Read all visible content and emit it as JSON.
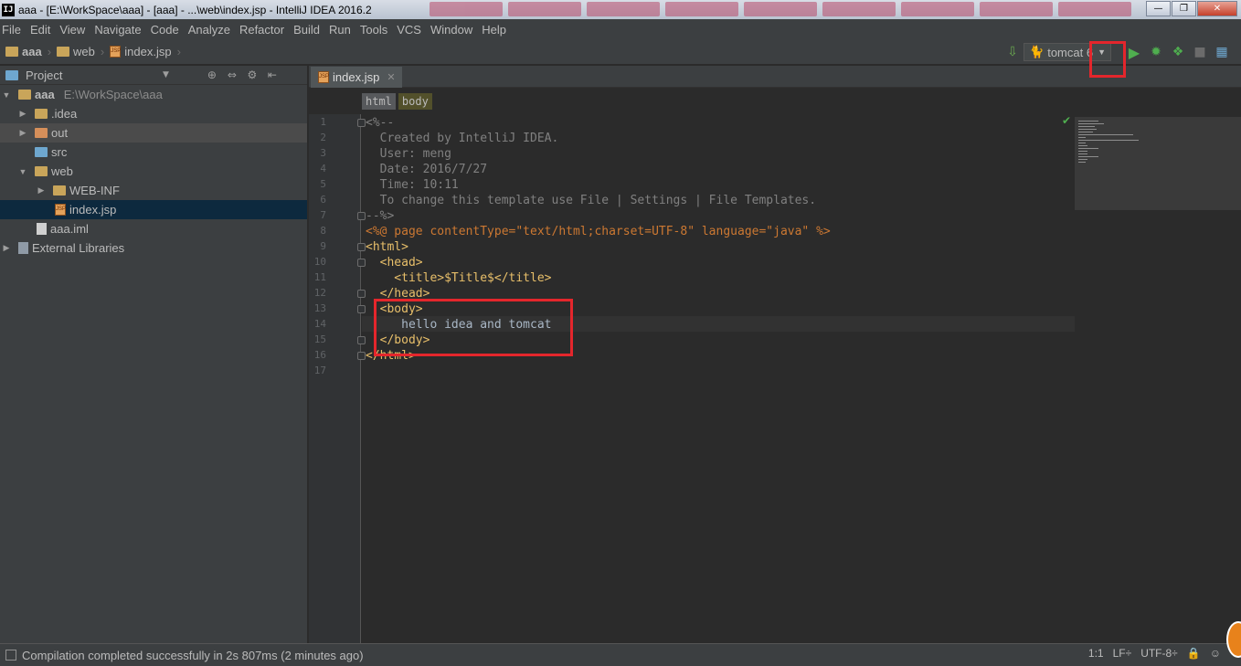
{
  "window": {
    "app_icon": "IJ",
    "title": "aaa - [E:\\WorkSpace\\aaa] - [aaa] - ...\\web\\index.jsp - IntelliJ IDEA 2016.2",
    "minimize": "—",
    "maximize": "❐",
    "close": "✕"
  },
  "menu": [
    "File",
    "Edit",
    "View",
    "Navigate",
    "Code",
    "Analyze",
    "Refactor",
    "Build",
    "Run",
    "Tools",
    "VCS",
    "Window",
    "Help"
  ],
  "navbar": {
    "crumbs": [
      "aaa",
      "web",
      "index.jsp"
    ],
    "run_config": "tomcat 6"
  },
  "project_panel": {
    "title": "Project",
    "tree": [
      {
        "label": "aaa",
        "path": "E:\\WorkSpace\\aaa"
      },
      {
        "label": ".idea"
      },
      {
        "label": "out"
      },
      {
        "label": "src"
      },
      {
        "label": "web"
      },
      {
        "label": "WEB-INF"
      },
      {
        "label": "index.jsp"
      },
      {
        "label": "aaa.iml"
      },
      {
        "label": "External Libraries"
      }
    ]
  },
  "editor": {
    "tab_label": "index.jsp",
    "tag_breadcrumbs": [
      "html",
      "body"
    ],
    "line_numbers": [
      "1",
      "2",
      "3",
      "4",
      "5",
      "6",
      "7",
      "8",
      "9",
      "10",
      "11",
      "12",
      "13",
      "14",
      "15",
      "16",
      "17"
    ],
    "lines": [
      "<%--",
      "  Created by IntelliJ IDEA.",
      "  User: meng",
      "  Date: 2016/7/27",
      "  Time: 10:11",
      "  To change this template use File | Settings | File Templates.",
      "--%>",
      "<%@ page contentType=\"text/html;charset=UTF-8\" language=\"java\" %>",
      "<html>",
      "  <head>",
      "    <title>$Title$</title>",
      "  </head>",
      "  <body>",
      "     hello idea and tomcat",
      "  </body>",
      "</html>",
      ""
    ]
  },
  "status_bar": {
    "message": "Compilation completed successfully in 2s 807ms (2 minutes ago)",
    "position": "1:1",
    "line_separator": "LF÷",
    "encoding": "UTF-8÷"
  },
  "colors": {
    "highlight": "#e4262c",
    "run_green": "#4fae4f"
  }
}
